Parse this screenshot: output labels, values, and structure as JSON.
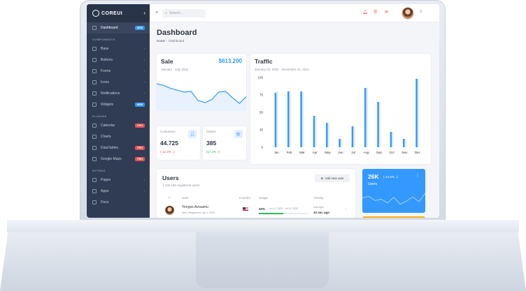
{
  "sidebar": {
    "brand": "COREUI",
    "toggle_icon": "chevron-left-icon",
    "dashboard": {
      "label": "Dashboard",
      "badge": "NEW"
    },
    "components_title": "COMPONENTS",
    "components": [
      {
        "label": "Base"
      },
      {
        "label": "Buttons"
      },
      {
        "label": "Forms"
      },
      {
        "label": "Icons"
      },
      {
        "label": "Notifications"
      },
      {
        "label": "Widgets",
        "badge": "NEW"
      }
    ],
    "plugins_title": "PLUGINS",
    "plugins": [
      {
        "label": "Calendar",
        "badge": "PRO"
      },
      {
        "label": "Charts"
      },
      {
        "label": "DataTables",
        "badge": "PRO"
      },
      {
        "label": "Google Maps",
        "badge": "PRO"
      }
    ],
    "extras_title": "EXTRAS",
    "extras": [
      {
        "label": "Pages"
      },
      {
        "label": "Apps"
      },
      {
        "label": "Docs"
      }
    ]
  },
  "header": {
    "search_placeholder": "Search...",
    "icons": [
      "bell-icon",
      "list-icon",
      "envelope-icon",
      "menu-icon"
    ]
  },
  "page": {
    "title": "Dashboard",
    "breadcrumb": [
      "Home",
      "Dashboard"
    ]
  },
  "sale": {
    "title": "Sale",
    "value": "$613.200",
    "period": "January - July 2022",
    "trend": [
      0.72,
      0.68,
      0.6,
      0.55,
      0.5,
      0.52,
      0.28,
      0.22,
      0.3,
      0.5,
      0.52,
      0.35,
      0.2,
      0.38
    ]
  },
  "customers": {
    "label": "Customers",
    "value": "44.725",
    "delta": "(-12.4% ↓)",
    "delta_color": "#e55353"
  },
  "orders": {
    "label": "Orders",
    "value": "385",
    "delta": "(17.2% ↑)",
    "delta_color": "#2eb85c"
  },
  "traffic": {
    "title": "Traffic",
    "period": "January 01, 2021 - December 31, 2021"
  },
  "chart_data": {
    "type": "bar",
    "title": "Traffic",
    "categories": [
      "Jan",
      "Feb",
      "Mar",
      "Apr",
      "May",
      "Jun",
      "Jul",
      "Aug",
      "Sep",
      "Oct",
      "Nov",
      "Dec"
    ],
    "series": [
      {
        "values": [
          78,
          80,
          80,
          45,
          35,
          12,
          30,
          85,
          65,
          22,
          12,
          98
        ]
      },
      {
        "values": [
          80,
          80,
          80,
          45,
          35,
          12,
          30,
          85,
          65,
          22,
          12,
          98
        ]
      }
    ],
    "yticks": [
      0,
      25,
      50,
      75,
      100
    ],
    "ylim": [
      0,
      100
    ],
    "colors": [
      "#3399ff",
      "#e3eefb"
    ]
  },
  "users": {
    "title": "Users",
    "subtitle": "1.232.150 registered users",
    "add_button": "Add new user",
    "columns": [
      "User",
      "Country",
      "Usage",
      "Activity"
    ],
    "rows": [
      {
        "name": "Yiorgos Avraamu",
        "meta": "New | Registered: Jan 1, 2023",
        "usage": "50%",
        "usage_range": "Jun 11, 2020 - Jul 10, 2020",
        "activity_label": "Last login",
        "activity": "10 sec ago",
        "flag": "us-flag-icon"
      }
    ]
  },
  "kpi": {
    "value": "26K",
    "delta": "(-12.4% ↓)",
    "label": "Users",
    "trend": [
      0.55,
      0.62,
      0.45,
      0.5,
      0.35,
      0.58,
      0.3,
      0.42,
      0.6,
      0.4,
      0.75
    ]
  }
}
